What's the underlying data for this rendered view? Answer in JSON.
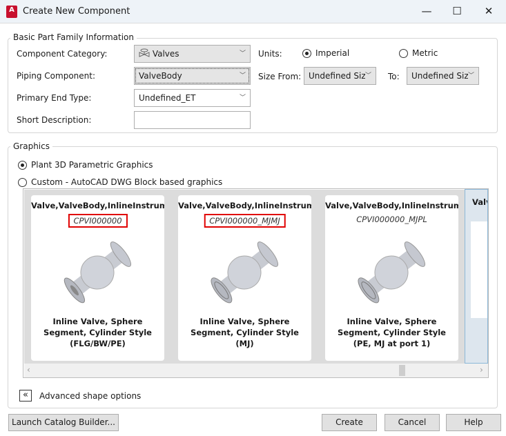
{
  "window": {
    "title": "Create New Component",
    "minimize": "—",
    "maximize": "☐",
    "close": "✕"
  },
  "basic": {
    "legend": "Basic Part Family Information",
    "category_label": "Component Category:",
    "category_value": "Valves",
    "piping_label": "Piping Component:",
    "piping_value": "ValveBody",
    "endtype_label": "Primary End Type:",
    "endtype_value": "Undefined_ET",
    "desc_label": "Short Description:",
    "desc_value": "",
    "units_label": "Units:",
    "imperial": "Imperial",
    "metric": "Metric",
    "units_selected": "Imperial",
    "size_from_label": "Size From:",
    "size_from_value": "Undefined Size",
    "to_label": "To:",
    "size_to_value": "Undefined Size"
  },
  "graphics": {
    "legend": "Graphics",
    "option_parametric": "Plant 3D Parametric Graphics",
    "option_custom": "Custom - AutoCAD DWG Block based graphics",
    "selected": "parametric",
    "cards": [
      {
        "title": "Valve,ValveBody,InlineInstrument",
        "code": "CPVI000000",
        "highlighted": true,
        "description": "Inline Valve, Sphere Segment, Cylinder Style (FLG/BW/PE)"
      },
      {
        "title": "Valve,ValveBody,InlineInstrument",
        "code": "CPVI000000_MJMJ",
        "highlighted": true,
        "description": "Inline Valve, Sphere Segment, Cylinder Style (MJ)"
      },
      {
        "title": "Valve,ValveBody,InlineInstrument",
        "code": "CPVI000000_MJPL",
        "highlighted": false,
        "description": "Inline Valve, Sphere Segment, Cylinder Style (PE, MJ at port 1)"
      },
      {
        "title": "Valv"
      }
    ],
    "advanced": "Advanced shape options"
  },
  "buttons": {
    "launch": "Launch Catalog Builder...",
    "create": "Create",
    "cancel": "Cancel",
    "help": "Help"
  },
  "colors": {
    "highlight": "#e00000",
    "titlebar": "#eef3f8"
  }
}
